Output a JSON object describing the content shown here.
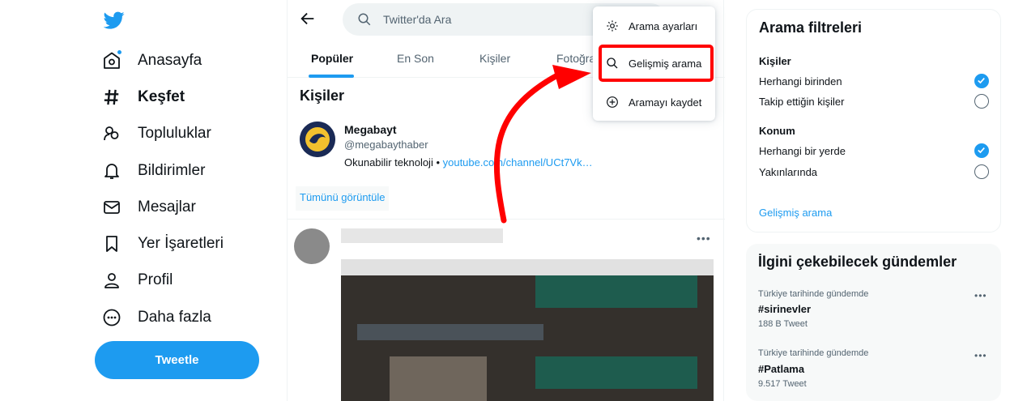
{
  "nav": {
    "items": [
      {
        "label": "Anasayfa"
      },
      {
        "label": "Keşfet"
      },
      {
        "label": "Topluluklar"
      },
      {
        "label": "Bildirimler"
      },
      {
        "label": "Mesajlar"
      },
      {
        "label": "Yer İşaretleri"
      },
      {
        "label": "Profil"
      },
      {
        "label": "Daha fazla"
      }
    ],
    "tweet_button": "Tweetle"
  },
  "search": {
    "placeholder": "Twitter'da Ara"
  },
  "tabs": [
    {
      "label": "Popüler"
    },
    {
      "label": "En Son"
    },
    {
      "label": "Kişiler"
    },
    {
      "label": "Fotoğra"
    }
  ],
  "people": {
    "title": "Kişiler",
    "user": {
      "name": "Megabayt",
      "handle": "@megabaythaber",
      "bio_text": "Okunabilir teknoloji • ",
      "bio_link": "youtube.com/channel/UCt7Vk…"
    },
    "show_all": "Tümünü görüntüle"
  },
  "menu": {
    "items": [
      {
        "label": "Arama ayarları"
      },
      {
        "label": "Gelişmiş arama"
      },
      {
        "label": "Aramayı kaydet"
      }
    ]
  },
  "filters": {
    "title": "Arama filtreleri",
    "people_title": "Kişiler",
    "people_opts": [
      {
        "label": "Herhangi birinden",
        "selected": true
      },
      {
        "label": "Takip ettiğin kişiler",
        "selected": false
      }
    ],
    "location_title": "Konum",
    "location_opts": [
      {
        "label": "Herhangi bir yerde",
        "selected": true
      },
      {
        "label": "Yakınlarında",
        "selected": false
      }
    ],
    "advanced_link": "Gelişmiş arama"
  },
  "trends": {
    "title": "İlgini çekebilecek gündemler",
    "items": [
      {
        "meta": "Türkiye tarihinde gündemde",
        "tag": "#sirinevler",
        "count": "188 B Tweet"
      },
      {
        "meta": "Türkiye tarihinde gündemde",
        "tag": "#Patlama",
        "count": "9.517 Tweet"
      }
    ]
  },
  "colors": {
    "accent": "#1d9bf0",
    "annotation": "#ff0000"
  }
}
